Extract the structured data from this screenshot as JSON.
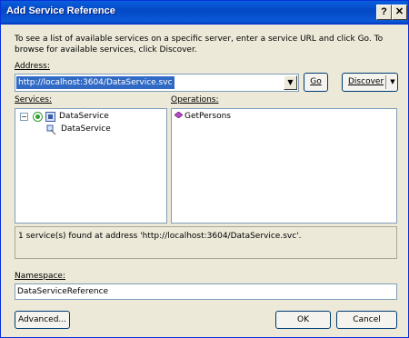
{
  "window": {
    "title": "Add Service Reference",
    "help_label": "?",
    "close_label": "✕"
  },
  "instructions": "To see a list of available services on a specific server, enter a service URL and click Go. To browse for available services, click Discover.",
  "address": {
    "label": "Address:",
    "value": "http://localhost:3604/DataService.svc",
    "dropdown_glyph": "▼"
  },
  "buttons": {
    "go": "Go",
    "discover": "Discover",
    "discover_arrow": "▼",
    "advanced": "Advanced...",
    "ok": "OK",
    "cancel": "Cancel"
  },
  "services": {
    "label": "Services:",
    "tree": [
      {
        "label": "DataService",
        "expander": "−",
        "icon": "service-icon"
      },
      {
        "label": "DataService",
        "icon": "contract-icon"
      }
    ]
  },
  "operations": {
    "label": "Operations:",
    "items": [
      {
        "label": "GetPersons",
        "icon": "method-icon"
      }
    ]
  },
  "status_text": "1 service(s) found at address 'http://localhost:3604/DataService.svc'.",
  "namespace": {
    "label": "Namespace:",
    "value": "DataServiceReference"
  },
  "colors": {
    "title_bar": "#0A5FDD",
    "dialog_bg": "#ECE9D8",
    "selection": "#316AC5",
    "input_border": "#7F9DB9"
  }
}
